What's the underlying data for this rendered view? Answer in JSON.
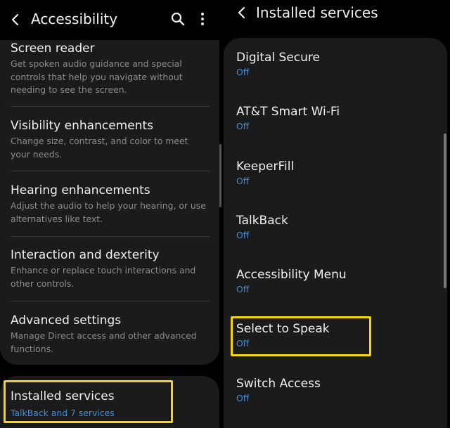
{
  "left": {
    "title": "Accessibility",
    "menu": [
      {
        "title": "Screen reader",
        "desc": "Get spoken audio guidance and special controls that help you navigate without needing to see the screen."
      },
      {
        "title": "Visibility enhancements",
        "desc": "Change size, contrast, and color to meet your needs."
      },
      {
        "title": "Hearing enhancements",
        "desc": "Adjust the audio to help your hearing, or use alternatives like text."
      },
      {
        "title": "Interaction and dexterity",
        "desc": "Enhance or replace touch interactions and other controls."
      },
      {
        "title": "Advanced settings",
        "desc": "Manage Direct access and other advanced functions."
      }
    ],
    "installed": {
      "title": "Installed services",
      "subtitle": "TalkBack and 7 services"
    }
  },
  "right": {
    "title": "Installed services",
    "services": [
      {
        "title": "Digital Secure",
        "status": "Off"
      },
      {
        "title": "AT&T Smart Wi-Fi",
        "status": "Off"
      },
      {
        "title": "KeeperFill",
        "status": "Off"
      },
      {
        "title": "TalkBack",
        "status": "Off"
      },
      {
        "title": "Accessibility Menu",
        "status": "Off"
      },
      {
        "title": "Select to Speak",
        "status": "Off"
      },
      {
        "title": "Switch Access",
        "status": "Off"
      }
    ]
  },
  "colors": {
    "accent_blue": "#3c8fe0",
    "highlight_yellow": "#f7d417",
    "card_bg": "#1b1b1b"
  },
  "icons": [
    "back-arrow-icon",
    "search-icon",
    "more-options-icon"
  ]
}
